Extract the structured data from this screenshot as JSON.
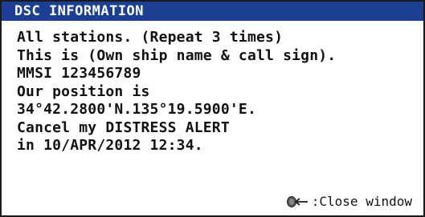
{
  "window": {
    "title": "DSC INFORMATION",
    "accent_color": "#1c3f94"
  },
  "message": {
    "lines": [
      "All stations. (Repeat 3 times)",
      "This is (Own ship name & call sign).",
      "MMSI 123456789",
      "Our position is",
      "34°42.2800'N.135°19.5900'E.",
      "Cancel my DISTRESS ALERT",
      "in 10/APR/2012 12:34."
    ]
  },
  "footer": {
    "icon": "enter-knob-icon",
    "label": ":Close window"
  }
}
